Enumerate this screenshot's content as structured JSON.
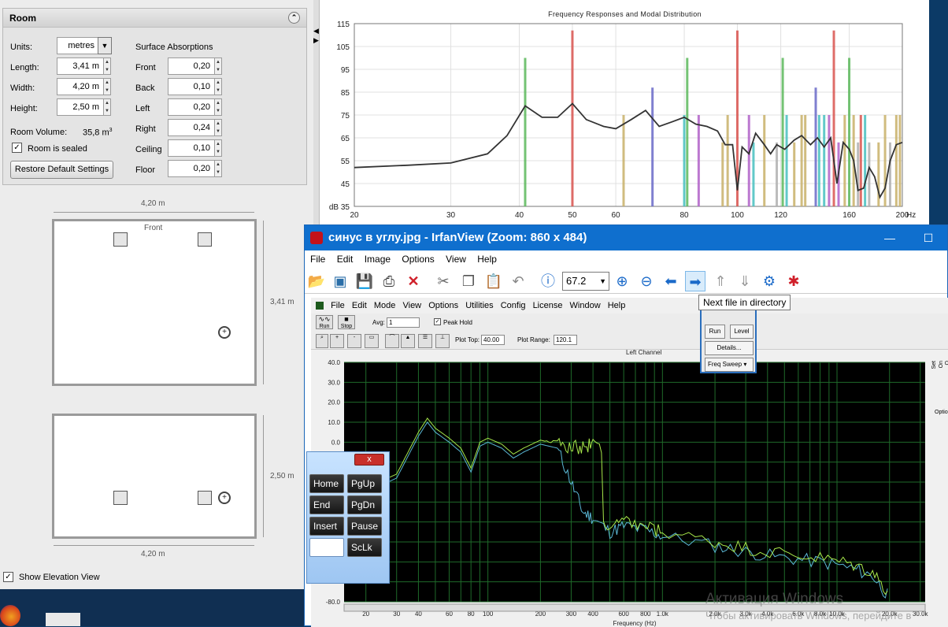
{
  "room": {
    "title": "Room",
    "units_label": "Units:",
    "units_value": "metres",
    "length_label": "Length:",
    "length_value": "3,41 m",
    "width_label": "Width:",
    "width_value": "4,20 m",
    "height_label": "Height:",
    "height_value": "2,50 m",
    "volume_label": "Room Volume:",
    "volume_value": "35,8 m",
    "volume_exp": "3",
    "sealed_label": "Room is sealed",
    "restore_label": "Restore Default Settings",
    "absorb_title": "Surface Absorptions",
    "surfaces": [
      {
        "label": "Front",
        "value": "0,20"
      },
      {
        "label": "Back",
        "value": "0,10"
      },
      {
        "label": "Left",
        "value": "0,20"
      },
      {
        "label": "Right",
        "value": "0,24"
      },
      {
        "label": "Ceiling",
        "value": "0,10"
      },
      {
        "label": "Floor",
        "value": "0,20"
      }
    ],
    "plan_width_top": "4,20 m",
    "plan_length": "3,41 m",
    "plan_front": "Front",
    "elev_height": "2,50 m",
    "elev_width": "4,20 m",
    "show_elev_label": "Show Elevation View"
  },
  "chart_data": {
    "type": "line",
    "title": "Frequency Responses and Modal Distribution",
    "ylabel": "dB",
    "xunit": "Hz",
    "yticks": [
      35,
      45,
      55,
      65,
      75,
      85,
      95,
      105,
      115
    ],
    "xticks": [
      20,
      30,
      40,
      50,
      60,
      80,
      100,
      120,
      160,
      200
    ],
    "xlim": [
      20,
      200
    ],
    "ylim": [
      35,
      115
    ],
    "response": [
      [
        20,
        52
      ],
      [
        25,
        53
      ],
      [
        30,
        54
      ],
      [
        35,
        58
      ],
      [
        38,
        66
      ],
      [
        41,
        79
      ],
      [
        44,
        74
      ],
      [
        47,
        74
      ],
      [
        50,
        80
      ],
      [
        53,
        73
      ],
      [
        57,
        70
      ],
      [
        60,
        69
      ],
      [
        64,
        73
      ],
      [
        68,
        77
      ],
      [
        72,
        70
      ],
      [
        76,
        72
      ],
      [
        80,
        74
      ],
      [
        84,
        71
      ],
      [
        88,
        70
      ],
      [
        92,
        68
      ],
      [
        95,
        62
      ],
      [
        98,
        62
      ],
      [
        100,
        42
      ],
      [
        102,
        61
      ],
      [
        105,
        58
      ],
      [
        108,
        67
      ],
      [
        112,
        62
      ],
      [
        115,
        58
      ],
      [
        118,
        62
      ],
      [
        122,
        60
      ],
      [
        127,
        64
      ],
      [
        131,
        66
      ],
      [
        136,
        62
      ],
      [
        140,
        65
      ],
      [
        144,
        61
      ],
      [
        148,
        65
      ],
      [
        152,
        45
      ],
      [
        156,
        63
      ],
      [
        160,
        60
      ],
      [
        163,
        55
      ],
      [
        166,
        42
      ],
      [
        170,
        43
      ],
      [
        174,
        52
      ],
      [
        178,
        48
      ],
      [
        182,
        39
      ],
      [
        186,
        43
      ],
      [
        190,
        55
      ],
      [
        195,
        62
      ],
      [
        200,
        63
      ]
    ],
    "modes": [
      {
        "f": 41,
        "h": 100,
        "c": "#5cb85c"
      },
      {
        "f": 50,
        "h": 112,
        "c": "#d9534f"
      },
      {
        "f": 62,
        "h": 75,
        "c": "#c8b068"
      },
      {
        "f": 70,
        "h": 87,
        "c": "#6a6ac8"
      },
      {
        "f": 80,
        "h": 75,
        "c": "#46c0c0"
      },
      {
        "f": 81,
        "h": 100,
        "c": "#5cb85c"
      },
      {
        "f": 85,
        "h": 75,
        "c": "#b060c8"
      },
      {
        "f": 94,
        "h": 63,
        "c": "#c8b068"
      },
      {
        "f": 96,
        "h": 75,
        "c": "#c8b068"
      },
      {
        "f": 100,
        "h": 112,
        "c": "#d9534f"
      },
      {
        "f": 105,
        "h": 75,
        "c": "#b060c8"
      },
      {
        "f": 107,
        "h": 63,
        "c": "#46c0c0"
      },
      {
        "f": 112,
        "h": 75,
        "c": "#c8b068"
      },
      {
        "f": 118,
        "h": 63,
        "c": "#b0b0b0"
      },
      {
        "f": 121,
        "h": 100,
        "c": "#5cb85c"
      },
      {
        "f": 123,
        "h": 75,
        "c": "#46c0c0"
      },
      {
        "f": 127,
        "h": 63,
        "c": "#c8b068"
      },
      {
        "f": 131,
        "h": 75,
        "c": "#c8b068"
      },
      {
        "f": 133,
        "h": 75,
        "c": "#c8b068"
      },
      {
        "f": 139,
        "h": 87,
        "c": "#6a6ac8"
      },
      {
        "f": 141,
        "h": 75,
        "c": "#46c0c0"
      },
      {
        "f": 144,
        "h": 75,
        "c": "#46c0c0"
      },
      {
        "f": 147,
        "h": 75,
        "c": "#b060c8"
      },
      {
        "f": 150,
        "h": 112,
        "c": "#d9534f"
      },
      {
        "f": 153,
        "h": 63,
        "c": "#b060c8"
      },
      {
        "f": 157,
        "h": 75,
        "c": "#c8b068"
      },
      {
        "f": 160,
        "h": 100,
        "c": "#5cb85c"
      },
      {
        "f": 163,
        "h": 75,
        "c": "#c8b068"
      },
      {
        "f": 166,
        "h": 63,
        "c": "#b0b0b0"
      },
      {
        "f": 168,
        "h": 75,
        "c": "#d9534f"
      },
      {
        "f": 171,
        "h": 75,
        "c": "#46c0c0"
      },
      {
        "f": 174,
        "h": 63,
        "c": "#b0b0b0"
      },
      {
        "f": 181,
        "h": 63,
        "c": "#c8b068"
      },
      {
        "f": 186,
        "h": 75,
        "c": "#c8b068"
      },
      {
        "f": 190,
        "h": 63,
        "c": "#b0b0b0"
      },
      {
        "f": 195,
        "h": 75,
        "c": "#c8b068"
      },
      {
        "f": 198,
        "h": 75,
        "c": "#c8b068"
      }
    ]
  },
  "irfanview": {
    "title": "синус в углу.jpg - IrfanView (Zoom: 860 x 484)",
    "min": "—",
    "max": "☐",
    "menu": [
      "File",
      "Edit",
      "Image",
      "Options",
      "View",
      "Help"
    ],
    "zoom": "67.2",
    "tooltip": "Next file in directory"
  },
  "rta": {
    "menu": [
      "File",
      "Edit",
      "Mode",
      "View",
      "Options",
      "Utilities",
      "Config",
      "License",
      "Window",
      "Help"
    ],
    "run": "Run",
    "stop": "Stop",
    "avg_label": "Avg:",
    "avg_value": "1",
    "peak_hold": "Peak Hold",
    "plot_top_label": "Plot Top:",
    "plot_top": "40.00",
    "plot_range_label": "Plot Range:",
    "plot_range": "120.1",
    "channel": "Left Channel",
    "popup_run": "Run",
    "popup_level": "Level",
    "popup_details": "Details...",
    "popup_mode": "Freq Sweep",
    "yticks": [
      "40.0",
      "30.0",
      "20.0",
      "10.0",
      "0.0",
      "-80.0"
    ],
    "xticks": [
      "20",
      "30",
      "40",
      "60",
      "80",
      "100",
      "200",
      "300",
      "400",
      "600",
      "800",
      "1.0k",
      "2.0k",
      "3.0k",
      "4.0k",
      "6.0k",
      "8.0k",
      "10.0k",
      "20.0k",
      "30.0k"
    ],
    "xlabel": "Frequency (Hz)",
    "side": [
      "Set",
      "On",
      "Q",
      "Optio"
    ]
  },
  "osk": {
    "keys": [
      "Home",
      "PgUp",
      "End",
      "PgDn",
      "Insert",
      "Pause",
      "",
      "ScLk"
    ],
    "close": "x"
  },
  "watermark": {
    "line1": "Активация Windows",
    "line2": "Чтобы активировать Windows, перейдите в"
  }
}
